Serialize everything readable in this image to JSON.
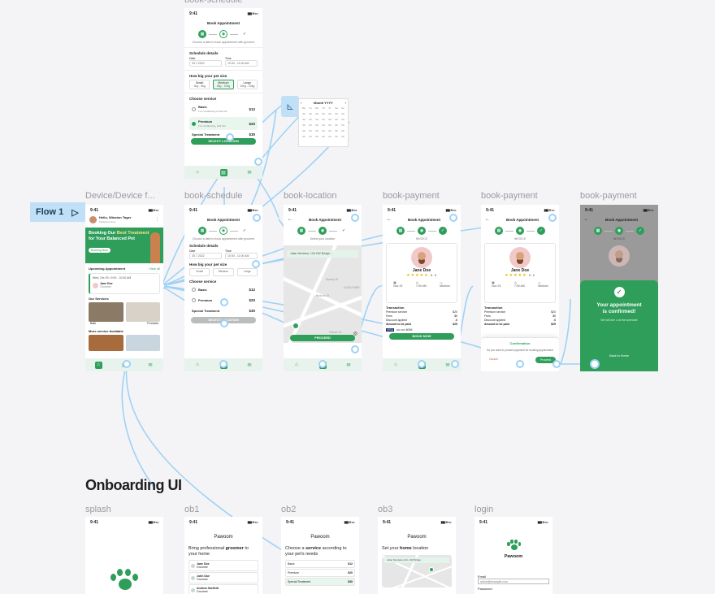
{
  "canvas": {
    "section_title": "Onboarding UI",
    "flow_label": "Flow 1",
    "connector_color": "#9fd2f6",
    "accent_color": "#2f9e5b"
  },
  "labels": {
    "top": "book-schedule",
    "device": "Device/Device f...",
    "schedule": "book-schedule",
    "location": "book-location",
    "payment1": "book-payment",
    "payment2": "book-payment",
    "payment3": "book-payment",
    "splash": "splash",
    "ob1": "ob1",
    "ob2": "ob2",
    "ob3": "ob3",
    "login": "login"
  },
  "status": {
    "time": "9:41",
    "signal": "▮▮▮ ≋ ▭"
  },
  "schedule_screen": {
    "title": "Book Appointment",
    "subtitle": "Choose a date to book appointment with groomer",
    "schedule_details": "Schedule details",
    "date_label": "Date",
    "date_value": "25.7.2022",
    "time_label": "Time",
    "time_value": "10:00 - 11:00 AM",
    "pet_size_label": "How big your pet size",
    "sizes": [
      {
        "name": "Small",
        "range": "1kg - 5kg"
      },
      {
        "name": "Medium",
        "range": "5kg - 10kg"
      },
      {
        "name": "Large",
        "range": "10kg - 20kg"
      }
    ],
    "service_label": "Choose service",
    "services": [
      {
        "name": "Basic",
        "desc": "Fur conditioning & Nail trim",
        "price": "$12"
      },
      {
        "name": "Premium",
        "desc": "Fur conditioning, Nail trim",
        "price": "$20"
      },
      {
        "name": "Special Treatment",
        "desc": "Full body groom",
        "price": "$30"
      }
    ],
    "button": "SELECT LOCATION"
  },
  "calendar_popup": {
    "title": "Month YYYY",
    "weekdays": [
      "Mo",
      "Tu",
      "We",
      "Th",
      "Fr",
      "Sa",
      "Su"
    ],
    "placeholder": "00"
  },
  "home_screen": {
    "greeting": "Hello, Winston Tager",
    "location": "Tiada Sun Ang",
    "banner_line1": "Booking Our",
    "banner_highlight": "Best Treatment",
    "banner_line2": "for Your Balanced Pet",
    "banner_button": "Booking Now",
    "upcoming_label": "Upcoming Appointment",
    "view_all": "View all",
    "appt_date": "Wed, Oct 25 • 9:00 - 10:00 AM",
    "groomer": "Jane Doe",
    "groomer_role": "Groomer",
    "services_label": "Our Services",
    "service_names": [
      "Bath",
      "Products"
    ],
    "more_label": "More service Available"
  },
  "location_screen": {
    "title": "Book Appointment",
    "subtitle": "Select your location",
    "search": "Jalan Merdeka, 12A HW Bridge...",
    "map_labels": [
      "Disney St",
      "GLEN PARK",
      "Beacon St",
      "Palmer St"
    ],
    "button": "PROCEED"
  },
  "payment_screen": {
    "title": "Book Appointment",
    "invoice": "INVOICE",
    "groomer": "Jane Doe",
    "stars": "★★★★★",
    "rating": "5.0",
    "meta": [
      "Nov 23",
      "7:00 AM",
      "Medium"
    ],
    "transaction": "Transaction",
    "rows": [
      {
        "k": "Premium service",
        "v": "$20"
      },
      {
        "k": "Fees",
        "v": "$5"
      },
      {
        "k": "Discount applied",
        "v": "-$"
      },
      {
        "k": "Amount to be paid",
        "v": "$25"
      }
    ],
    "card": "VISA",
    "card_num": "•••• •••• 6094",
    "button": "BOOK NOW"
  },
  "confirm_sheet": {
    "title": "Confirmation",
    "body": "Do you want to proceed payment for booking appointment",
    "cancel": "Cancel",
    "proceed": "Proceed"
  },
  "success_screen": {
    "title_line1": "Your appointment",
    "title_line2": "is confirmed!",
    "sub": "We will see u at the schedule",
    "button": "Back to Home"
  },
  "onboarding": {
    "app_name": "Pawoom",
    "ob1_title_a": "Bring professional",
    "ob1_title_b": "groomer",
    "ob1_title_c": "to your home",
    "ob1_items": [
      {
        "name": "Jane Doe",
        "role": "Groomer"
      },
      {
        "name": "John Doe",
        "role": "Groomer"
      },
      {
        "name": "Andrew Garfield",
        "role": "Groomer"
      }
    ],
    "ob2_title_a": "Choose a",
    "ob2_title_b": "service",
    "ob2_title_c": "according to your pet's needs",
    "ob2_items": [
      {
        "name": "Basic",
        "price": "$12"
      },
      {
        "name": "Premium",
        "price": "$20"
      },
      {
        "name": "Special Treatment",
        "price": "$30"
      }
    ],
    "ob3_title_a": "Set your",
    "ob3_title_b": "home",
    "ob3_title_c": "location",
    "ob3_search": "Jalan Merdeka 12A, HW Bridge",
    "login_email_label": "Email",
    "login_email_placeholder": "admin@example.com",
    "login_password_label": "Password"
  }
}
